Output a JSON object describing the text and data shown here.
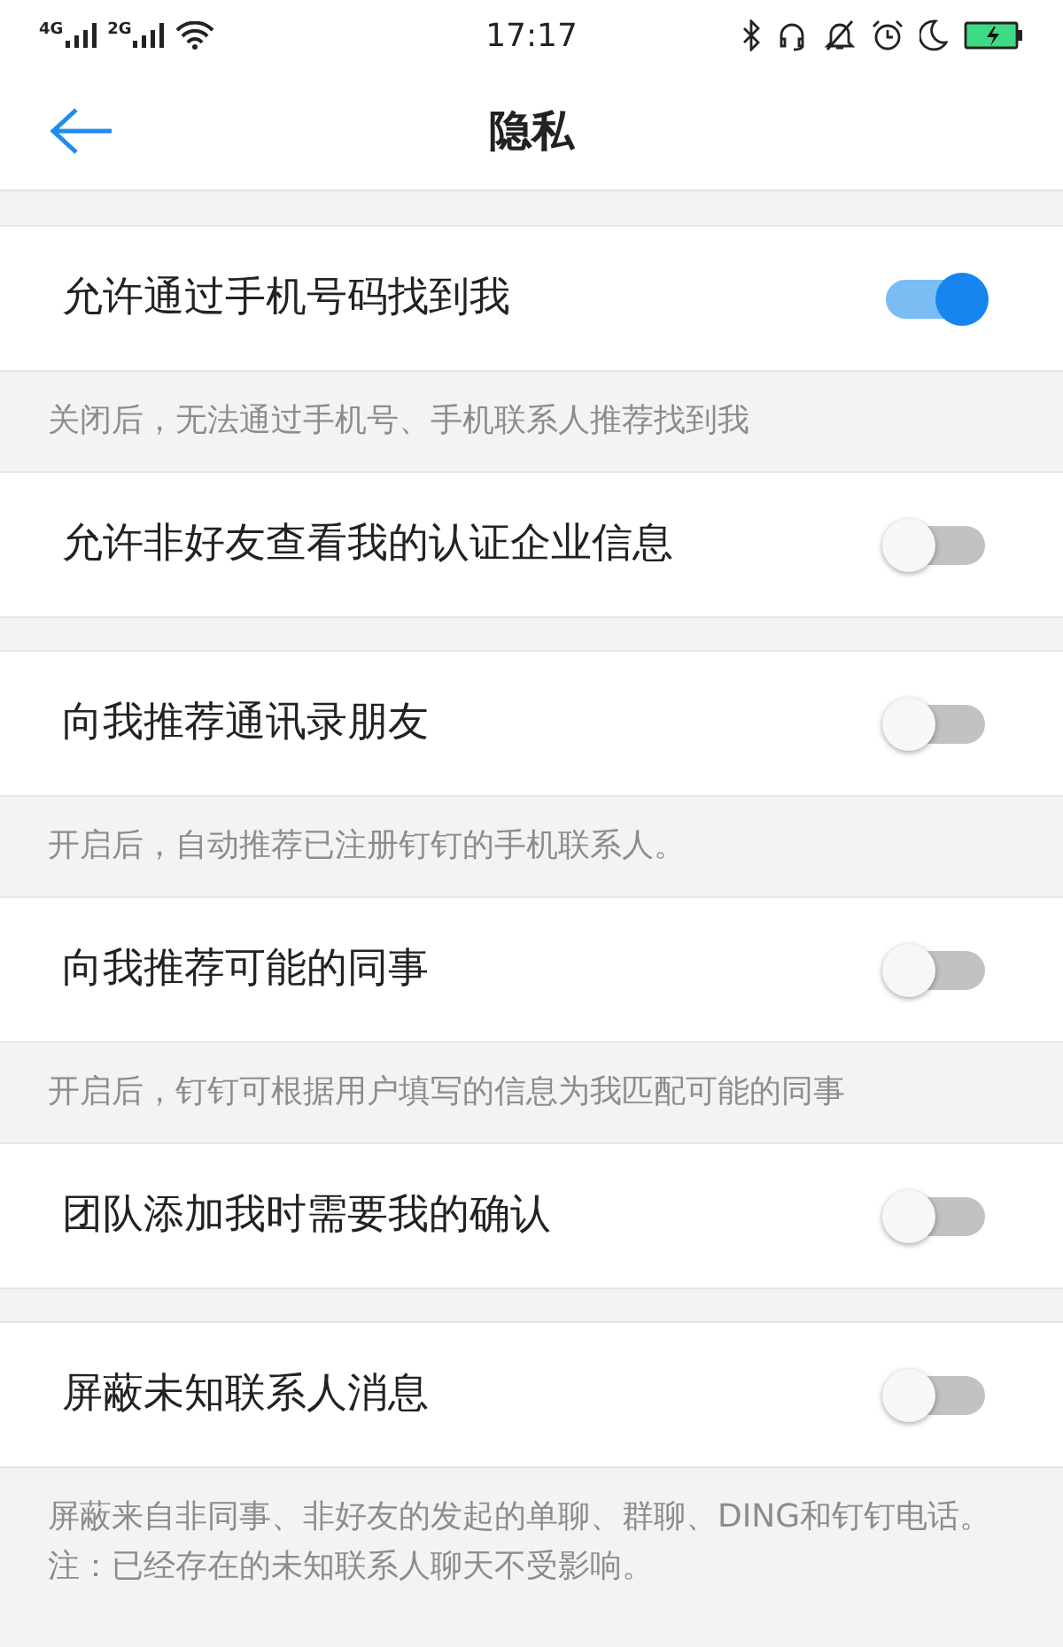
{
  "status_bar": {
    "signal_1": "4G",
    "signal_2": "2G",
    "time": "17:17"
  },
  "header": {
    "title": "隐私"
  },
  "settings": [
    {
      "label": "允许通过手机号码找到我",
      "on": true,
      "note": "关闭后，无法通过手机号、手机联系人推荐找到我"
    },
    {
      "label": "允许非好友查看我的认证企业信息",
      "on": false
    },
    {
      "label": "向我推荐通讯录朋友",
      "on": false,
      "note": "开启后，自动推荐已注册钉钉的手机联系人。"
    },
    {
      "label": "向我推荐可能的同事",
      "on": false,
      "note": "开启后，钉钉可根据用户填写的信息为我匹配可能的同事"
    },
    {
      "label": "团队添加我时需要我的确认",
      "on": false
    },
    {
      "label": "屏蔽未知联系人消息",
      "on": false,
      "note": "屏蔽来自非同事、非好友的发起的单聊、群聊、DING和钉钉电话。注：已经存在的未知联系人聊天不受影响。"
    }
  ]
}
